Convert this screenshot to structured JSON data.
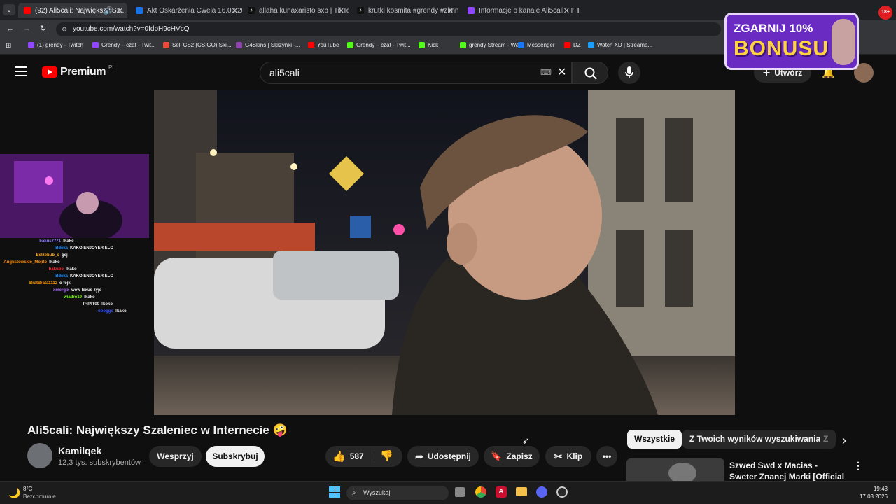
{
  "browser": {
    "tabs": [
      {
        "label": "(92) Ali5cali: Największy Sz...",
        "active": true,
        "favicon_color": "#ff0000"
      },
      {
        "label": "Akt Oskarżenia Cwela 16.03.20...",
        "active": false,
        "favicon_color": "#1a73e8"
      },
      {
        "label": "allaha kunaxaristo sxb | TikTok",
        "active": false,
        "favicon_color": "#000000"
      },
      {
        "label": "krutki kosmita #grendy #zimne...",
        "active": false,
        "favicon_color": "#000000"
      },
      {
        "label": "Informacje o kanale Ali5cali - Tw...",
        "active": false,
        "favicon_color": "#9146ff"
      }
    ],
    "url": "youtube.com/watch?v=0fdpH9cHVcQ",
    "bookmarks": [
      {
        "label": "(1) grendy - Twitch",
        "color": "#9146ff"
      },
      {
        "label": "Grendy – czat - Twit...",
        "color": "#9146ff"
      },
      {
        "label": "Sell CS2 (CS:GO) Ski...",
        "color": "#e74c3c"
      },
      {
        "label": "G4Skins | Skrzynki -...",
        "color": "#8e44ad"
      },
      {
        "label": "YouTube",
        "color": "#ff0000"
      },
      {
        "label": "Grendy – czat - Twit...",
        "color": "#53fc18"
      },
      {
        "label": "Kick",
        "color": "#53fc18"
      },
      {
        "label": "grendy Stream - Wa...",
        "color": "#53fc18"
      },
      {
        "label": "Messenger",
        "color": "#1877f2"
      },
      {
        "label": "DZ",
        "color": "#ff0000"
      },
      {
        "label": "Watch XD | Streama...",
        "color": "#1a9fff"
      }
    ]
  },
  "youtube": {
    "logo_text": "Premium",
    "logo_sup": "PL",
    "search_value": "ali5cali",
    "create_label": "Utwórz"
  },
  "promo": {
    "line1": "ZGARNIJ 10%",
    "line2": "BONUSU"
  },
  "video": {
    "title": "Ali5cali: Największy Szaleniec w Internecie 🤪",
    "channel": "Kamilqek",
    "subscribers": "12,3 tys. subskrybentów",
    "support_label": "Wesprzyj",
    "subscribe_label": "Subskrybuj",
    "likes": "587",
    "share_label": "Udostępnij",
    "save_label": "Zapisz",
    "clip_label": "Klip"
  },
  "chips": [
    "Wszystkie",
    "Z Twoich wyników wyszukiwania",
    "Z"
  ],
  "recommended": {
    "title": "Szwed Swd x Macias - Sweter Znanej Marki [Official Music ..."
  },
  "chat": [
    {
      "user": "bakus7771",
      "msg": "!kako",
      "color": "#8a7bff"
    },
    {
      "user": "Iddeka",
      "msg": "KAKO ENJOYER ELO",
      "color": "#1e90ff"
    },
    {
      "user": "Belzebub_o",
      "msg": "gej",
      "color": "#ffb020"
    },
    {
      "user": "Augustowskie_Mojito",
      "msg": "!kako",
      "color": "#ff8c00"
    },
    {
      "user": "bakubo",
      "msg": "!kako",
      "color": "#ff3030"
    },
    {
      "user": "Iddeka",
      "msg": "KAKO ENJOYER ELO",
      "color": "#1e90ff"
    },
    {
      "user": "BratBrata1112",
      "msg": "o fejk",
      "color": "#ff9900"
    },
    {
      "user": "xmergix",
      "msg": "wow lexus żyje",
      "color": "#b070ff"
    },
    {
      "user": "wiadro19",
      "msg": "!kako",
      "color": "#7cfc00"
    },
    {
      "user": "P4PIT00",
      "msg": "!koko",
      "color": "#e0e0e0"
    },
    {
      "user": "oboggo",
      "msg": "!kako",
      "color": "#3050ff"
    }
  ],
  "taskbar": {
    "weather_temp": "8°C",
    "weather_desc": "Bezchmurnie",
    "search_placeholder": "Wyszukaj",
    "time": "19:43",
    "date": "17.03.2026"
  }
}
